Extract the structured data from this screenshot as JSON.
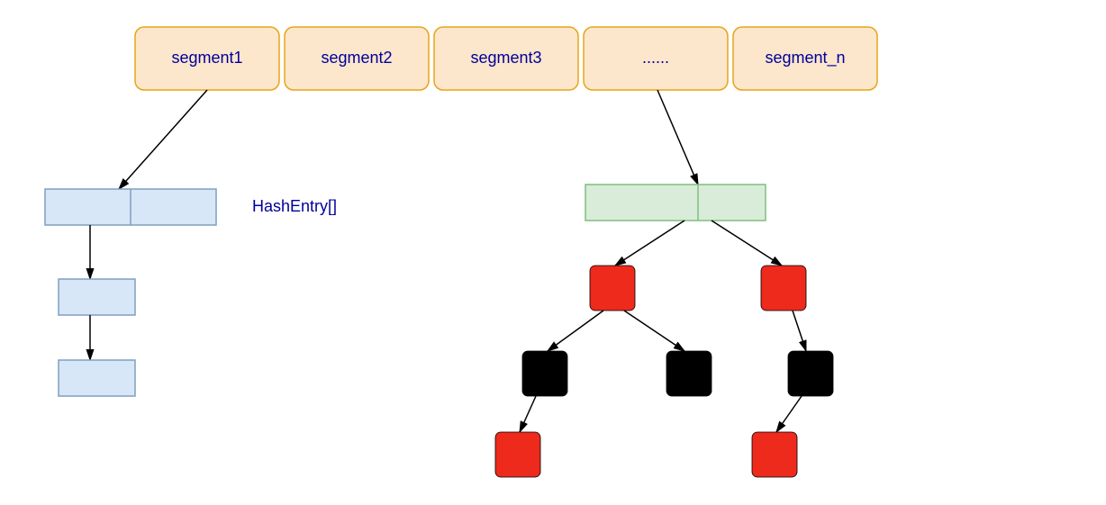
{
  "segments": {
    "s1": "segment1",
    "s2": "segment2",
    "s3": "segment3",
    "s4": "......",
    "s5": "segment_n"
  },
  "labels": {
    "hashEntry": "HashEntry[]"
  },
  "colors": {
    "segment_fill": "#fce6cc",
    "segment_stroke": "#e6a519",
    "text_blue": "#000099",
    "list_fill": "#d7e7f7",
    "list_stroke": "#7f9fbf",
    "tree_array_fill": "#d9ecd9",
    "tree_array_stroke": "#7fbf7f",
    "red_node": "#ed2a1c",
    "black_node": "#000000"
  },
  "diagram_semantics": {
    "description": "ConcurrentHashMap internal structure: an array of Segment objects; each segment holds a HashEntry[] table. One segment's bucket is shown as a linked list (blue), another segment's bucket is shown as a red-black tree (treeified bin).",
    "left_structure": "linked-list",
    "right_structure": "red-black-tree"
  }
}
